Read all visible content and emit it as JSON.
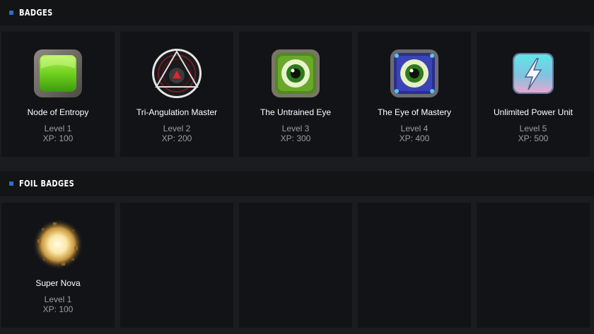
{
  "sections": [
    {
      "title": "BADGES",
      "cards": [
        {
          "name": "Node of Entropy",
          "level": "Level 1",
          "xp": "XP: 100",
          "icon": "green-gem-icon"
        },
        {
          "name": "Tri-Angulation Master",
          "level": "Level 2",
          "xp": "XP: 200",
          "icon": "triangle-circle-icon"
        },
        {
          "name": "The Untrained Eye",
          "level": "Level 3",
          "xp": "XP: 300",
          "icon": "green-eye-icon"
        },
        {
          "name": "The Eye of Mastery",
          "level": "Level 4",
          "xp": "XP: 400",
          "icon": "blue-eye-icon"
        },
        {
          "name": "Unlimited Power Unit",
          "level": "Level 5",
          "xp": "XP: 500",
          "icon": "lightning-bolt-icon"
        }
      ]
    },
    {
      "title": "FOIL BADGES",
      "cards": [
        {
          "name": "Super Nova",
          "level": "Level 1",
          "xp": "XP: 100",
          "icon": "supernova-icon"
        }
      ]
    }
  ],
  "colors": {
    "background": "#1b1c1f",
    "header_background": "#131416",
    "card_background": "#121316",
    "accent": "#2c6fc4",
    "muted_text": "#9a9da3"
  }
}
